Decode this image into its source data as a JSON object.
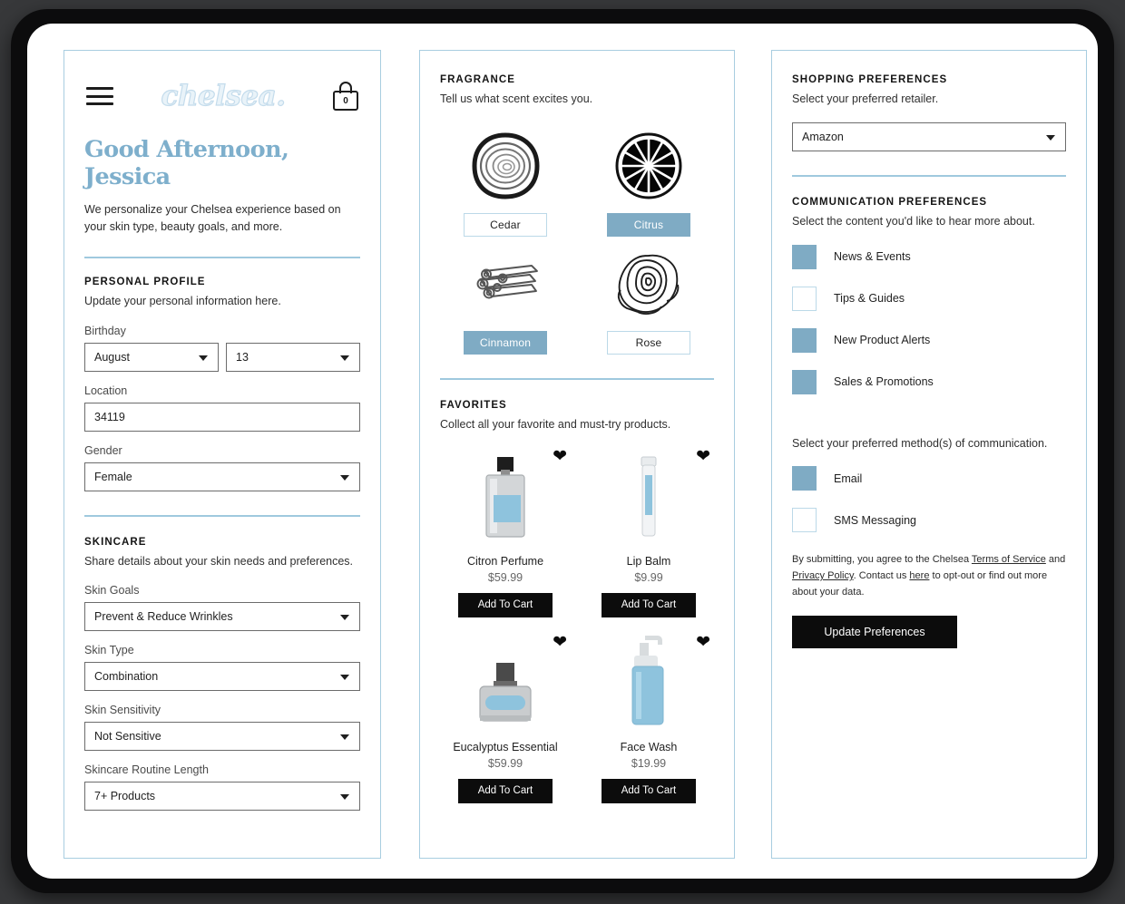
{
  "app": {
    "brand": "chelsea.",
    "bag_count": "0",
    "menu_icon": "hamburger-menu-icon",
    "bag_icon": "shopping-bag-icon"
  },
  "profile_panel": {
    "greeting": "Good Afternoon, Jessica",
    "intro": "We personalize your Chelsea experience based on your skin type, beauty goals, and more.",
    "personal": {
      "title": "PERSONAL PROFILE",
      "subtitle": "Update your personal information here.",
      "birthday_label": "Birthday",
      "birthday_month": "August",
      "birthday_day": "13",
      "location_label": "Location",
      "location_value": "34119",
      "gender_label": "Gender",
      "gender_value": "Female"
    },
    "skincare": {
      "title": "SKINCARE",
      "subtitle": "Share details about your skin needs and preferences.",
      "goals_label": "Skin Goals",
      "goals_value": "Prevent & Reduce Wrinkles",
      "type_label": "Skin Type",
      "type_value": "Combination",
      "sensitivity_label": "Skin Sensitivity",
      "sensitivity_value": "Not Sensitive",
      "routine_label": "Skincare Routine Length",
      "routine_value": "7+ Products"
    }
  },
  "fragrance_panel": {
    "title": "FRAGRANCE",
    "subtitle": "Tell us what scent excites you.",
    "options": [
      {
        "label": "Cedar",
        "icon": "cedar-wood-ring-icon",
        "selected": false
      },
      {
        "label": "Citrus",
        "icon": "citrus-slice-icon",
        "selected": true
      },
      {
        "label": "Cinnamon",
        "icon": "cinnamon-sticks-icon",
        "selected": true
      },
      {
        "label": "Rose",
        "icon": "rose-flower-icon",
        "selected": false
      }
    ],
    "favorites": {
      "title": "FAVORITES",
      "subtitle": "Collect all your favorite and must-try products.",
      "cart_label": "Add To Cart",
      "products": [
        {
          "name": "Citron Perfume",
          "price": "$59.99",
          "art": "perfume-bottle",
          "favorited": true
        },
        {
          "name": "Lip Balm",
          "price": "$9.99",
          "art": "lip-balm-tube",
          "favorited": true
        },
        {
          "name": "Eucalyptus Essential",
          "price": "$59.99",
          "art": "essential-oil-jar",
          "favorited": true
        },
        {
          "name": "Face Wash",
          "price": "$19.99",
          "art": "face-wash-pump",
          "favorited": true
        }
      ]
    }
  },
  "prefs_panel": {
    "shopping": {
      "title": "SHOPPING PREFERENCES",
      "subtitle": "Select your preferred retailer.",
      "retailer_value": "Amazon"
    },
    "communication": {
      "title": "COMMUNICATION PREFERENCES",
      "subtitle": "Select the content you'd like to hear more about.",
      "content_options": [
        {
          "label": "News & Events",
          "checked": true
        },
        {
          "label": "Tips & Guides",
          "checked": false
        },
        {
          "label": "New Product Alerts",
          "checked": true
        },
        {
          "label": "Sales & Promotions",
          "checked": true
        }
      ],
      "method_subtitle": "Select your preferred method(s) of communication.",
      "method_options": [
        {
          "label": "Email",
          "checked": true
        },
        {
          "label": "SMS Messaging",
          "checked": false
        }
      ]
    },
    "legal": {
      "part1": "By submitting, you agree to the Chelsea ",
      "link1": "Terms of Service",
      "part2": " and ",
      "link2": "Privacy Policy",
      "part3": ". Contact us ",
      "link3": "here",
      "part4": " to opt-out or find out more about your data."
    },
    "update_button": "Update Preferences"
  },
  "colors": {
    "accent_blue": "#7fabc4",
    "brand_blue": "#7eafcc",
    "divider_blue": "#9fc9de",
    "panel_border": "#a8cde0",
    "button_black": "#0c0c0c"
  }
}
